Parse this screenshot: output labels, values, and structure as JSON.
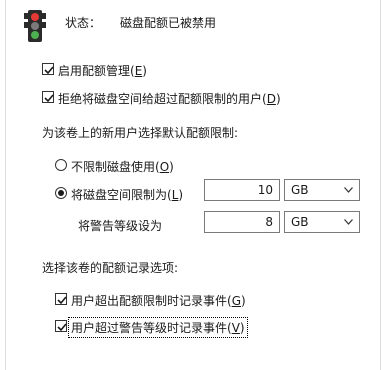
{
  "status": {
    "label": "状态：",
    "value": "磁盘配额已被禁用"
  },
  "options": {
    "enable_quota": {
      "text": "启用配额管理(",
      "key": "E",
      "close": ")",
      "checked": true
    },
    "deny_space": {
      "text": "拒绝将磁盘空间给超过配额限制的用户(",
      "key": "D",
      "close": ")",
      "checked": true
    }
  },
  "default_limit_heading": "为该卷上的新用户选择默认配额限制:",
  "no_limit": {
    "text": "不限制磁盘使用(",
    "key": "O",
    "close": ")",
    "selected": false
  },
  "limit": {
    "text": "将磁盘空间限制为(",
    "key": "L",
    "close": ")",
    "selected": true,
    "value": "10",
    "unit": "GB"
  },
  "warning": {
    "text": "将警告等级设为",
    "value": "8",
    "unit": "GB"
  },
  "logging_heading": "选择该卷的配额记录选项:",
  "log_over_limit": {
    "text": "用户超出配额限制时记录事件(",
    "key": "G",
    "close": ")",
    "checked": true
  },
  "log_over_warning": {
    "text": "用户超过警告等级时记录事件(",
    "key": "V",
    "close": ")",
    "checked": true
  }
}
